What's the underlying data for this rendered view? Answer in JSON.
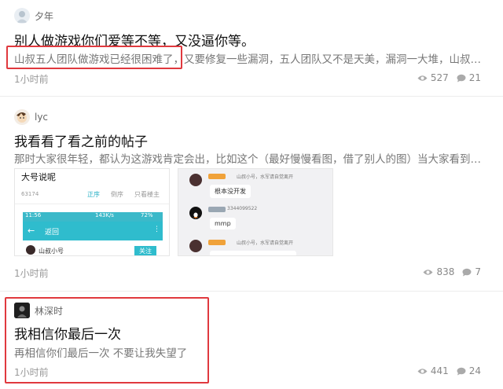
{
  "posts": [
    {
      "author": "夕年",
      "title": "别人做游戏你们爱等不等，又没逼你等。",
      "excerpt": "山叔五人团队做游戏已经很困难了，又要修复一些漏洞，五人团队又不是天美，漏洞一大堆，山叔虽…",
      "time": "1小时前",
      "views": "527",
      "comments": "21"
    },
    {
      "author": "lyc",
      "title": "我看看了看之前的帖子",
      "excerpt": "那时大家很年轻，都认为这游戏肯定会出，比如这个（最好慢慢看图，借了别人的图）当大家看到时…",
      "time": "1小时前",
      "views": "838",
      "comments": "7",
      "image1": {
        "header": "大号说呢",
        "count": "63174",
        "tab_sort": "正序",
        "tab_reverse": "倒序",
        "tab_author": "只看楼主",
        "status_time": "11:56",
        "status_net": "143K/s",
        "status_battery": "72%",
        "back_label": "返回",
        "user": "山叔小号",
        "follow": "关注"
      },
      "image2": {
        "user_line": "山叔小号，水军请自觉离开",
        "bubble1": "根本没开发",
        "qq": "3344099522",
        "bubble2": "mmp"
      }
    },
    {
      "author": "林深时",
      "title": "我相信你最后一次",
      "excerpt": "再相信你们最后一次 不要让我失望了",
      "time": "1小时前",
      "views": "441",
      "comments": "24"
    }
  ]
}
